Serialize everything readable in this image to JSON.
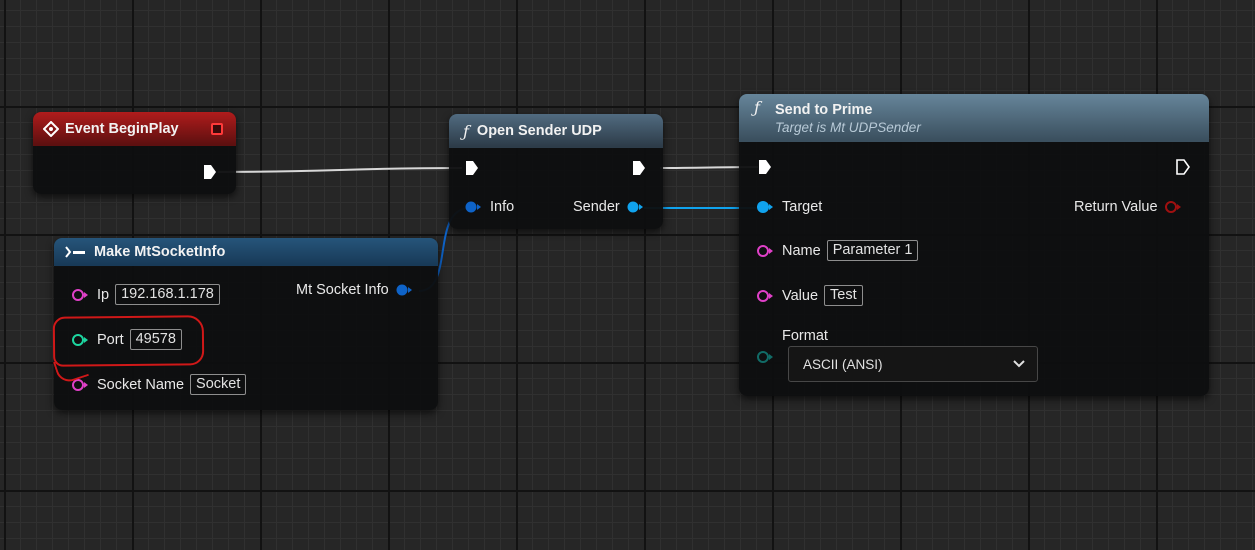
{
  "colors": {
    "exec": "#ffffff",
    "struct_pin": "#0e63c8",
    "object_pin": "#10a3ee",
    "string_pin": "#e040c8",
    "int_pin": "#1dd6a0",
    "byte_pin": "#116b66",
    "return_pin": "#a01010",
    "event_header": "#b01c1c",
    "function_header": "#516b80",
    "annotation": "#d01818"
  },
  "event_node": {
    "title": "Event BeginPlay",
    "icon": "event-diamond-icon"
  },
  "open_sender_node": {
    "title": "Open Sender UDP",
    "icon": "function-icon",
    "info_label": "Info",
    "sender_label": "Sender"
  },
  "make_socket_node": {
    "title": "Make MtSocketInfo",
    "icon": "make-struct-icon",
    "ip_label": "Ip",
    "ip_value": "192.168.1.178",
    "port_label": "Port",
    "port_value": "49578",
    "socket_label": "Socket Name",
    "socket_value": "Socket",
    "output_label": "Mt Socket Info"
  },
  "send_node": {
    "title": "Send to Prime",
    "subtitle": "Target is Mt UDPSender",
    "icon": "function-icon",
    "target_label": "Target",
    "return_label": "Return Value",
    "name_label": "Name",
    "name_value": "Parameter 1",
    "value_label": "Value",
    "value_value": "Test",
    "format_label": "Format",
    "format_value": "ASCII (ANSI)"
  }
}
